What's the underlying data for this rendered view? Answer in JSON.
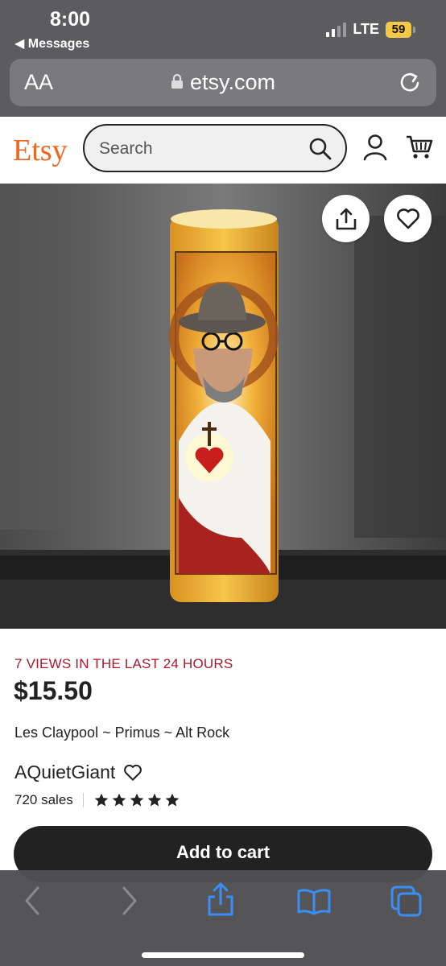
{
  "status_bar": {
    "time": "8:00",
    "back_label": "◀ Messages",
    "network": "LTE",
    "battery": "59",
    "battery_color": "#f5c945"
  },
  "browser": {
    "text_size_label": "AA",
    "url": "etsy.com",
    "icons": [
      "lock-icon",
      "reload-icon"
    ]
  },
  "etsy_header": {
    "logo": "Etsy",
    "logo_color": "#f1641e",
    "search_placeholder": "Search",
    "icons": [
      "search-icon",
      "user-icon",
      "cart-icon"
    ]
  },
  "product_image": {
    "icons": [
      "share-icon",
      "heart-icon"
    ]
  },
  "listing": {
    "views_notice": "7 VIEWS IN THE LAST 24 HOURS",
    "views_color": "#a61a2e",
    "price": "$15.50",
    "title": "Les Claypool ~ Primus ~ Alt Rock",
    "shop_name": "AQuietGiant",
    "sales": "720 sales",
    "rating_stars": 5,
    "add_to_cart_label": "Add to cart"
  },
  "toolbar": {
    "icons": [
      "back-arrow-icon",
      "forward-arrow-icon",
      "share-icon",
      "bookmarks-icon",
      "tabs-icon"
    ]
  }
}
